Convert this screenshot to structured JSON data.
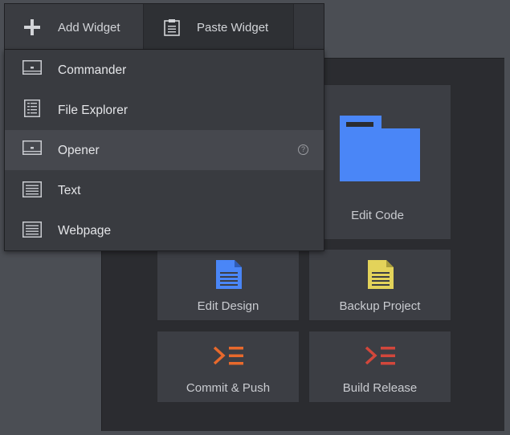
{
  "toolbar": {
    "add_widget": "Add Widget",
    "paste_widget": "Paste Widget"
  },
  "menu": {
    "items": [
      {
        "label": "Commander",
        "icon": "commander-icon"
      },
      {
        "label": "File Explorer",
        "icon": "file-explorer-icon"
      },
      {
        "label": "Opener",
        "icon": "opener-icon",
        "highlighted": true
      },
      {
        "label": "Text",
        "icon": "text-icon"
      },
      {
        "label": "Webpage",
        "icon": "webpage-icon"
      }
    ],
    "help_glyph": "?"
  },
  "dashboard": {
    "tiles": [
      {
        "label": "Edit Code",
        "icon": "folder-icon",
        "color": "#4a86f7"
      },
      {
        "label": "Edit Design",
        "icon": "document-icon",
        "color": "#4a86f7"
      },
      {
        "label": "Backup Project",
        "icon": "document-icon",
        "color": "#e3d35a"
      },
      {
        "label": "Commit & Push",
        "icon": "terminal-icon",
        "color": "#e8692c"
      },
      {
        "label": "Build Release",
        "icon": "terminal-icon",
        "color": "#d2473b"
      }
    ]
  },
  "colors": {
    "background": "#4b4e54",
    "menu": "#393b40",
    "menu_highlight": "#46484e",
    "accent_blue": "#4a86f7"
  }
}
